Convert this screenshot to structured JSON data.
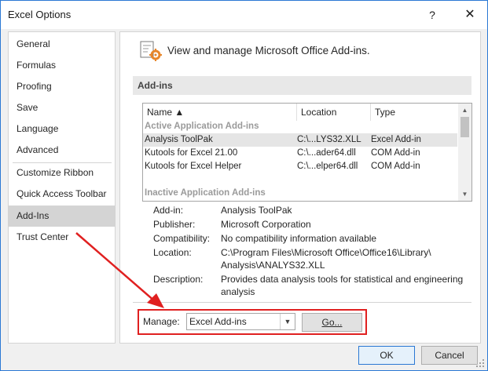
{
  "window": {
    "title": "Excel Options",
    "help_glyph": "?",
    "close_glyph": "✕"
  },
  "sidebar": {
    "items": [
      {
        "label": "General"
      },
      {
        "label": "Formulas"
      },
      {
        "label": "Proofing"
      },
      {
        "label": "Save"
      },
      {
        "label": "Language"
      },
      {
        "label": "Advanced"
      },
      {
        "label": "Customize Ribbon"
      },
      {
        "label": "Quick Access Toolbar"
      },
      {
        "label": "Add-Ins",
        "selected": true
      },
      {
        "label": "Trust Center"
      }
    ]
  },
  "main": {
    "header_text": "View and manage Microsoft Office Add-ins.",
    "section_title": "Add-ins",
    "list": {
      "columns": [
        "Name ▲",
        "Location",
        "Type"
      ],
      "active_group": "Active Application Add-ins",
      "inactive_group": "Inactive Application Add-ins",
      "rows": [
        {
          "name": "Analysis ToolPak",
          "location": "C:\\...LYS32.XLL",
          "type": "Excel Add-in",
          "selected": true
        },
        {
          "name": "Kutools for Excel 21.00",
          "location": "C:\\...ader64.dll",
          "type": "COM Add-in"
        },
        {
          "name": "Kutools for Excel Helper",
          "location": "C:\\...elper64.dll",
          "type": "COM Add-in"
        }
      ],
      "scroll_up": "▲",
      "scroll_down": "▼"
    },
    "details": {
      "addin_label": "Add-in:",
      "addin_value": "Analysis ToolPak",
      "publisher_label": "Publisher:",
      "publisher_value": "Microsoft Corporation",
      "compat_label": "Compatibility:",
      "compat_value": "No compatibility information available",
      "location_label": "Location:",
      "location_value_1": "C:\\Program Files\\Microsoft Office\\Office16\\Library\\",
      "location_value_2": "Analysis\\ANALYS32.XLL",
      "desc_label": "Description:",
      "desc_value_1": "Provides data analysis tools for statistical and engineering",
      "desc_value_2": "analysis"
    },
    "manage": {
      "label": "Manage:",
      "selected": "Excel Add-ins",
      "go_label": "Go..."
    }
  },
  "footer": {
    "ok_label": "OK",
    "cancel_label": "Cancel"
  },
  "colors": {
    "annotation_red": "#e02020",
    "accent_blue": "#2b78d4",
    "icon_orange": "#e8862a"
  }
}
